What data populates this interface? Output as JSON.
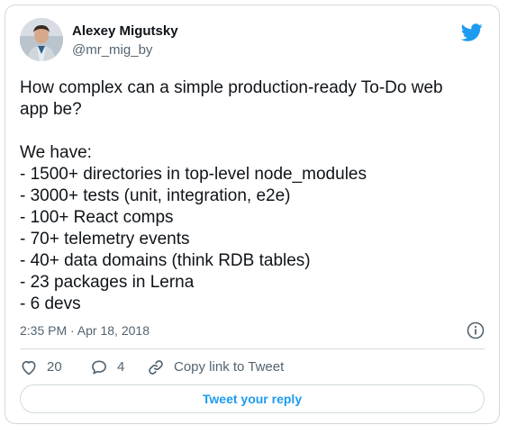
{
  "author": {
    "display_name": "Alexey Migutsky",
    "handle": "@mr_mig_by"
  },
  "tweet": {
    "lines": [
      "How complex can a simple production-ready To-Do web",
      "app be?",
      "",
      "We have:",
      "- 1500+ directories in top-level node_modules",
      "- 3000+ tests (unit, integration, e2e)",
      "- 100+ React comps",
      "- 70+ telemetry events",
      "- 40+ data domains (think RDB tables)",
      "- 23 packages in Lerna",
      "- 6 devs"
    ],
    "timestamp": "2:35 PM · Apr 18, 2018"
  },
  "actions": {
    "likes": "20",
    "replies": "4",
    "copy_link_label": "Copy link to Tweet"
  },
  "reply_button_label": "Tweet your reply",
  "icons": {
    "brand": "twitter-bird-icon",
    "like": "heart-icon",
    "reply": "speech-bubble-icon",
    "link": "link-icon",
    "info": "info-icon"
  },
  "colors": {
    "brand_blue": "#1d9bf0",
    "text_primary": "#0f1419",
    "text_secondary": "#536471",
    "border": "#cfd9de"
  }
}
